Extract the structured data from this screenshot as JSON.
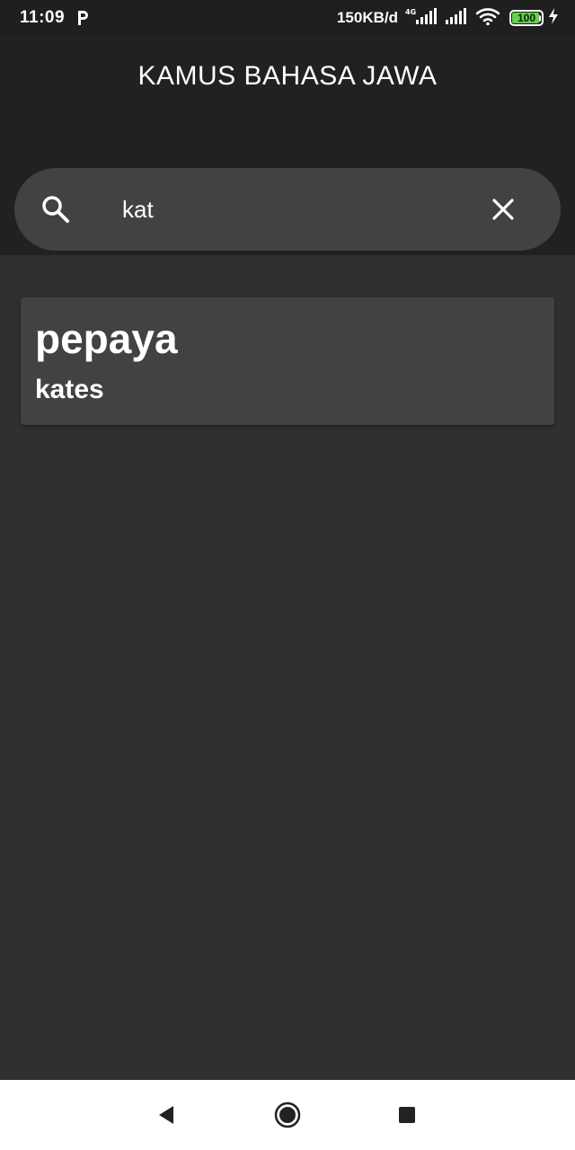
{
  "status_bar": {
    "time": "11:09",
    "speed": "150KB/d",
    "network": "4G",
    "battery": "100"
  },
  "app": {
    "title": "KAMUS BAHASA JAWA"
  },
  "search": {
    "value": "kat",
    "icon": "search-icon",
    "clear_icon": "close-icon"
  },
  "results": [
    {
      "word": "pepaya",
      "translation": "kates"
    }
  ],
  "colors": {
    "appbar": "#212121",
    "background": "#303030",
    "card": "#424242",
    "battery": "#5fd345"
  }
}
